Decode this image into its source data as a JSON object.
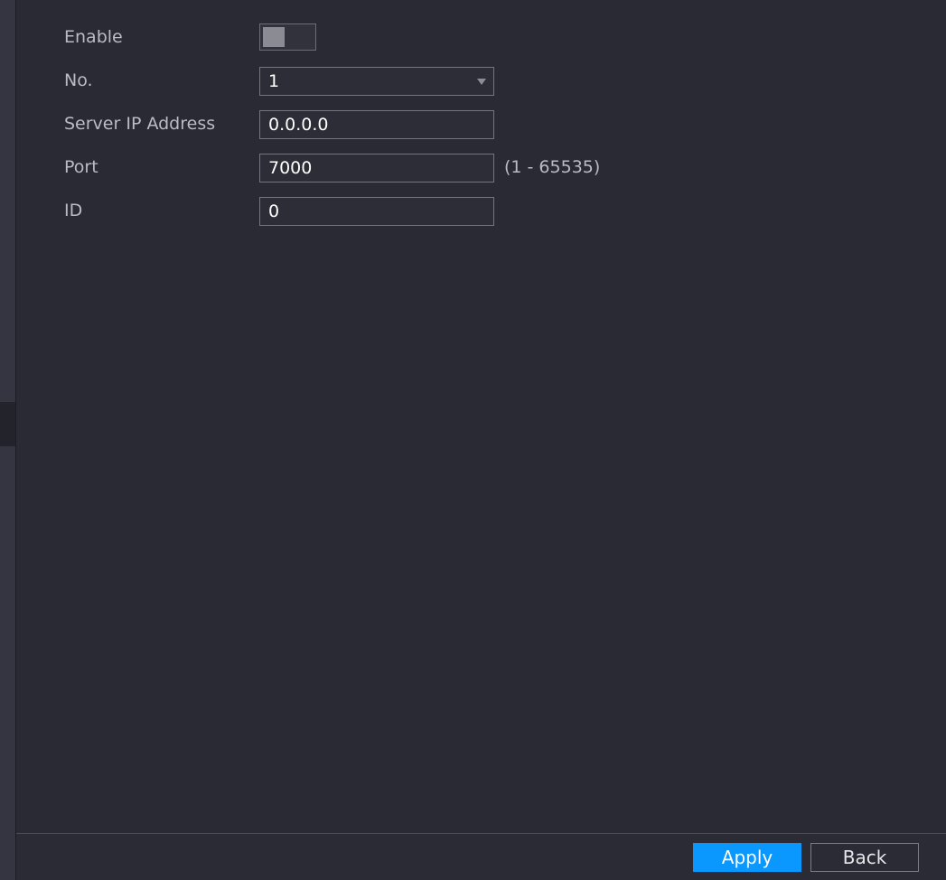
{
  "form": {
    "enable": {
      "label": "Enable",
      "checked": false
    },
    "number": {
      "label": "No.",
      "value": "1"
    },
    "server_ip": {
      "label": "Server IP Address",
      "value": "0.0.0.0"
    },
    "port": {
      "label": "Port",
      "value": "7000",
      "hint": "(1 - 65535)"
    },
    "id": {
      "label": "ID",
      "value": "0"
    }
  },
  "footer": {
    "apply_label": "Apply",
    "back_label": "Back"
  },
  "colors": {
    "background": "#292a33",
    "accent": "#0a98ff",
    "label_text": "#b9bcc4",
    "value_text": "#ffffff"
  },
  "icons": {
    "dropdown": "chevron-down-icon"
  }
}
